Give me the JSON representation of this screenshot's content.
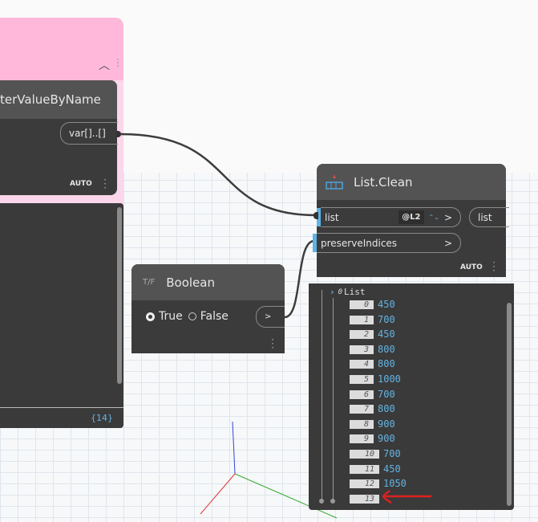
{
  "param_node": {
    "title": "terValueByName",
    "output_port": "var[]..[]",
    "lacing": "AUTO",
    "preview_count": "{14}"
  },
  "list_clean": {
    "title": "List.Clean",
    "inputs": [
      {
        "label": "list",
        "level": "@L2"
      },
      {
        "label": "preserveIndices"
      }
    ],
    "output": "list",
    "lacing": "AUTO",
    "arrow": ">"
  },
  "boolean": {
    "title": "Boolean",
    "icon_text": "T/F",
    "options": [
      "True",
      "False"
    ],
    "selected": "True",
    "output": ">"
  },
  "preview": {
    "header_index": "0",
    "header_label": "List",
    "items": [
      {
        "i": "0",
        "v": "450"
      },
      {
        "i": "1",
        "v": "700"
      },
      {
        "i": "2",
        "v": "450"
      },
      {
        "i": "3",
        "v": "800"
      },
      {
        "i": "4",
        "v": "800"
      },
      {
        "i": "5",
        "v": "1000"
      },
      {
        "i": "6",
        "v": "700"
      },
      {
        "i": "7",
        "v": "800"
      },
      {
        "i": "8",
        "v": "900"
      },
      {
        "i": "9",
        "v": "900"
      },
      {
        "i": "10",
        "v": "700"
      },
      {
        "i": "11",
        "v": "450"
      },
      {
        "i": "12",
        "v": "1050"
      },
      {
        "i": "13",
        "v": ""
      }
    ]
  },
  "colors": {
    "group_header": "#ffb8da",
    "group_body": "#fcd6ea",
    "node_body": "#3b3b3b",
    "accent": "#5fb3e4",
    "annotation": "#e02020"
  }
}
